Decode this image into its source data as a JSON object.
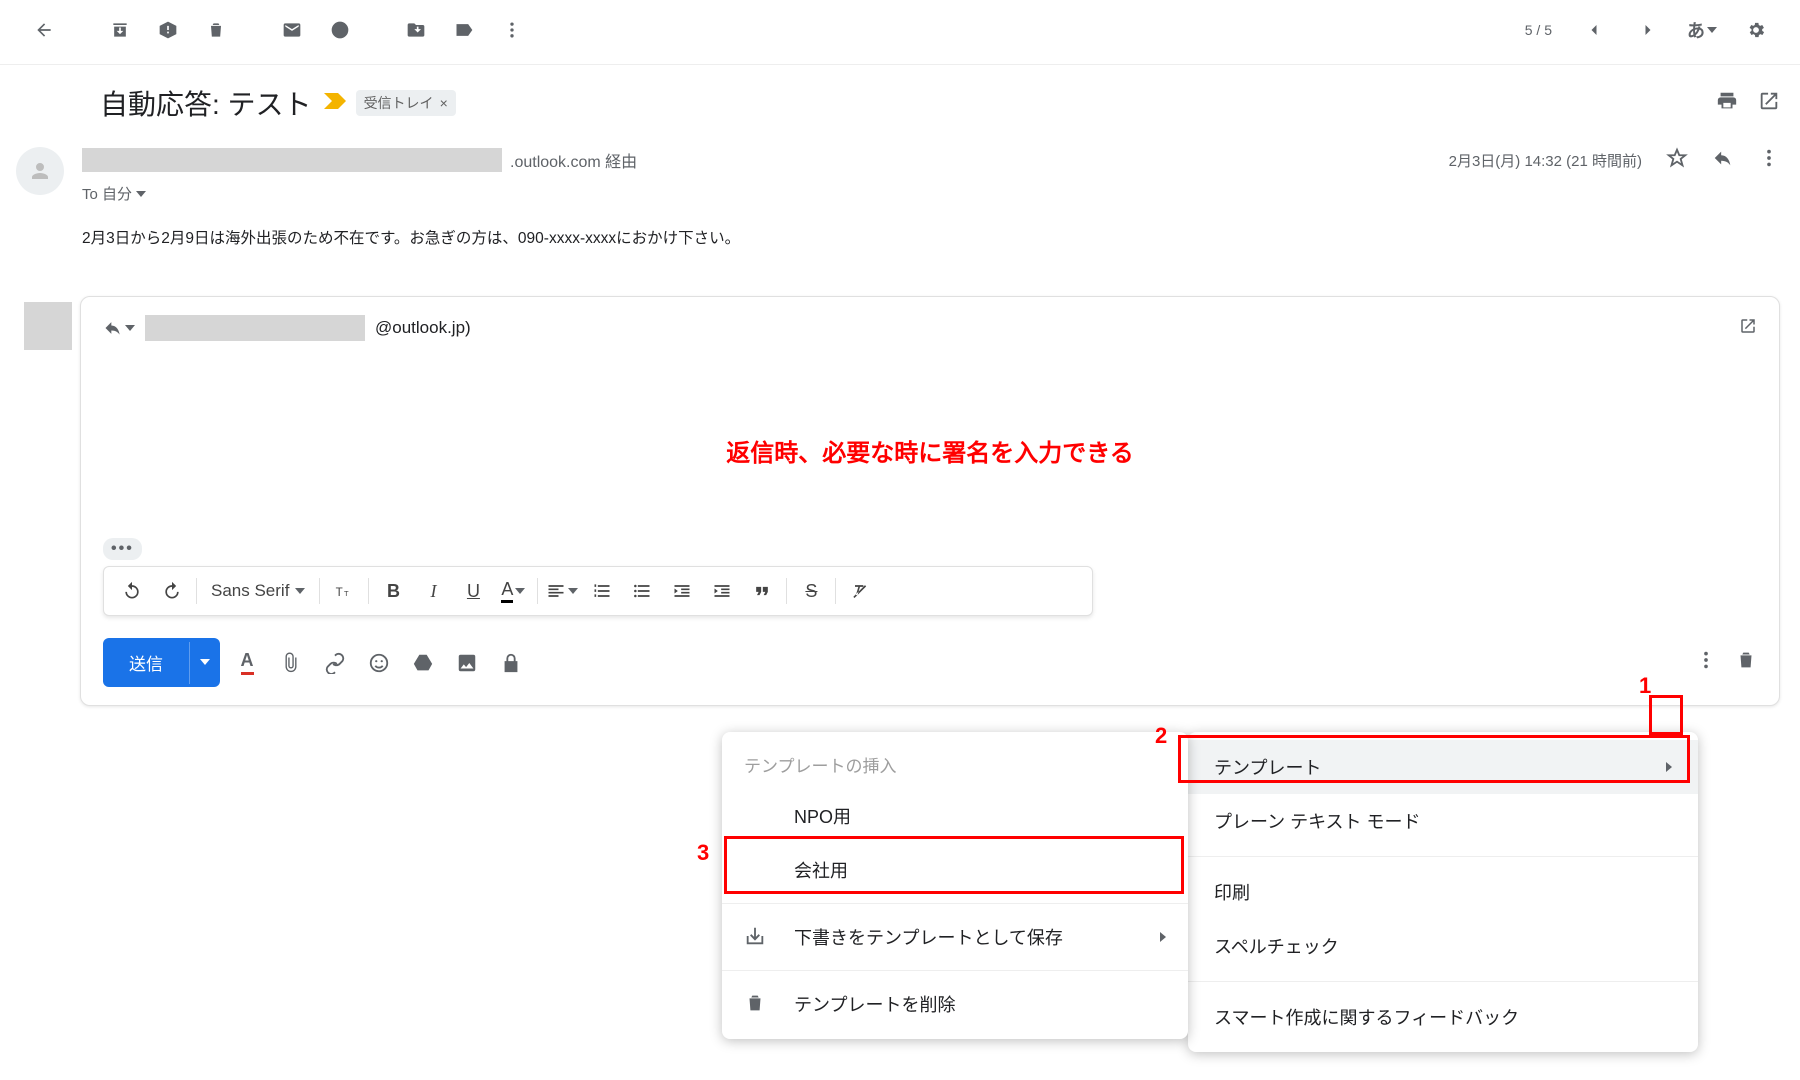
{
  "toolbar": {
    "page_counter": "5 / 5",
    "lang": "あ"
  },
  "subject": {
    "text": "自動応答: テスト",
    "inbox_chip": "受信トレイ"
  },
  "sender": {
    "via_suffix": ".outlook.com 経由",
    "timestamp": "2月3日(月) 14:32 (21 時間前)",
    "to_line": "To 自分"
  },
  "body": "2月3日から2月9日は海外出張のため不在です。お急ぎの方は、090-xxxx-xxxxにおかけ下さい。",
  "compose": {
    "recipient_suffix": "@outlook.jp)",
    "annotation": "返信時、必要な時に署名を入力できる",
    "font_label": "Sans Serif",
    "send_label": "送信",
    "format_a": "A"
  },
  "menu1": {
    "items": [
      "テンプレート",
      "プレーン テキスト モード",
      "印刷",
      "スペルチェック",
      "スマート作成に関するフィードバック"
    ]
  },
  "menu2": {
    "header": "テンプレートの挿入",
    "tpl1": "NPO用",
    "tpl2": "会社用",
    "save": "下書きをテンプレートとして保存",
    "delete": "テンプレートを削除"
  },
  "callouts": {
    "n1": "1",
    "n2": "2",
    "n3": "3"
  }
}
